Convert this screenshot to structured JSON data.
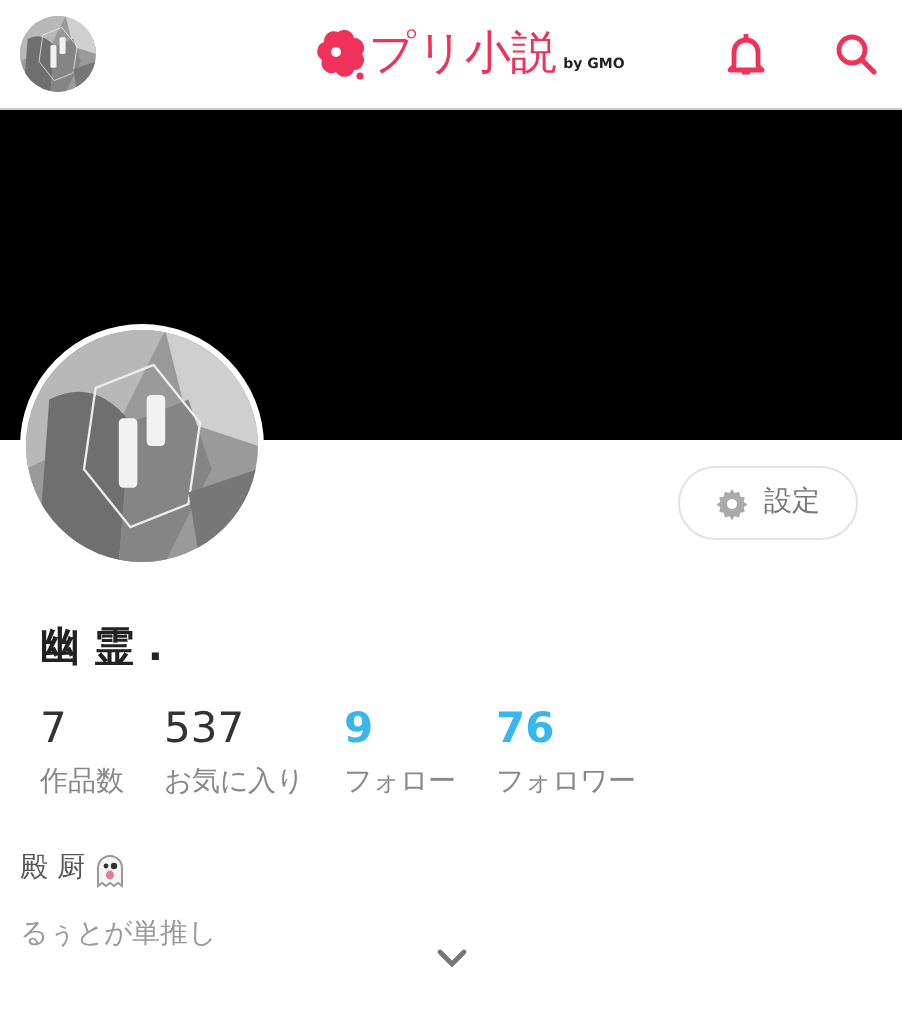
{
  "header": {
    "logo_text": "プリ小説",
    "logo_suffix": "by GMO"
  },
  "profile": {
    "name": "幽 霊 .",
    "settings_button": "設定"
  },
  "stats": [
    {
      "value": "7",
      "label": "作品数",
      "kind": "plain"
    },
    {
      "value": "537",
      "label": "お気に入り",
      "kind": "plain"
    },
    {
      "value": "9",
      "label": "フォロー",
      "kind": "link"
    },
    {
      "value": "76",
      "label": "フォロワー",
      "kind": "link"
    }
  ],
  "bio": {
    "line_1": "殿 厨",
    "line_2": "るぅとが単推し"
  }
}
